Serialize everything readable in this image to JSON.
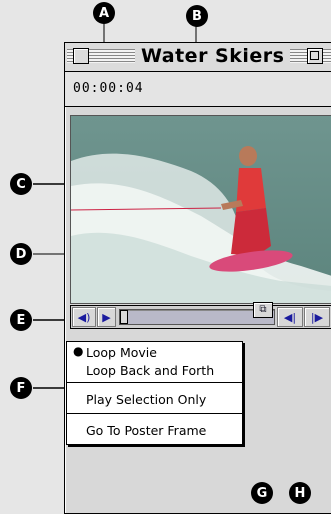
{
  "window": {
    "title": "Water Skiers",
    "timecode": "00:00:04"
  },
  "controller": {
    "speaker_icon": "speaker-icon",
    "play_icon": "play-icon",
    "step_back_icon": "step-back-icon",
    "step_forward_icon": "step-forward-icon"
  },
  "menu": {
    "items": [
      {
        "label": "Loop Movie",
        "checked": true
      },
      {
        "label": "Loop Back and Forth",
        "checked": false
      },
      {
        "label": "Play Selection Only",
        "checked": false
      },
      {
        "label": "Go To Poster Frame",
        "checked": false
      }
    ]
  },
  "callouts": [
    "A",
    "B",
    "C",
    "D",
    "E",
    "F",
    "G",
    "H"
  ]
}
